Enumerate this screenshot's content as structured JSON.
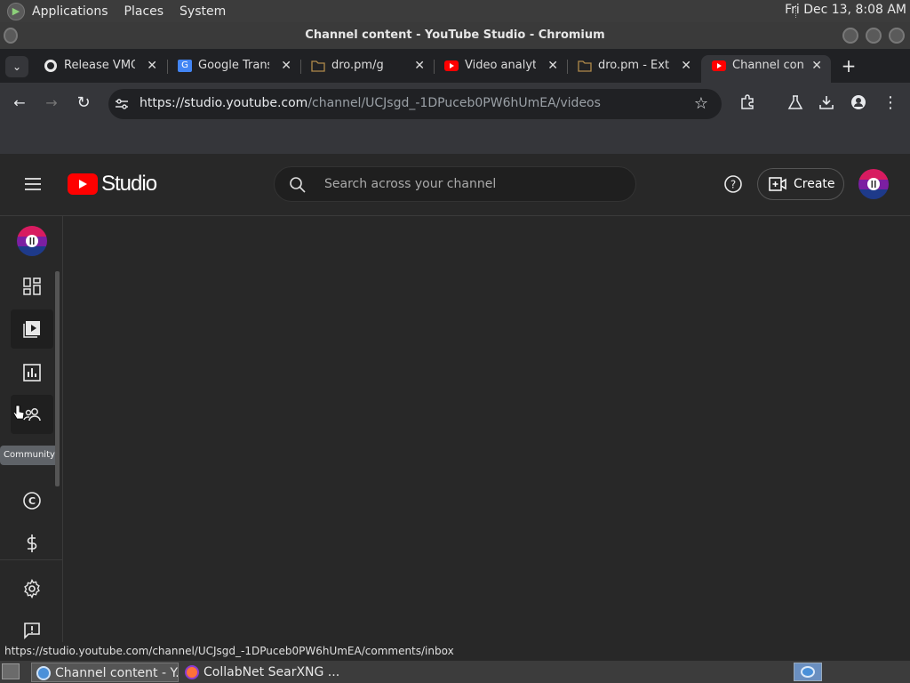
{
  "system_panel": {
    "menus": [
      "Applications",
      "Places",
      "System"
    ],
    "clock": "Fri Dec 13,  8:08 AM"
  },
  "window": {
    "title": "Channel content - YouTube Studio - Chromium"
  },
  "tabs": [
    {
      "label": "Release VMQ",
      "icon": "github-icon"
    },
    {
      "label": "Google Trans",
      "icon": "google-translate-icon"
    },
    {
      "label": "dro.pm/g",
      "icon": "folder-icon"
    },
    {
      "label": "Video analytic",
      "icon": "youtube-icon"
    },
    {
      "label": "dro.pm - Extr",
      "icon": "folder-icon"
    },
    {
      "label": "Channel cont",
      "icon": "youtube-icon",
      "active": true
    }
  ],
  "toolbar": {
    "url_host": "https://studio.youtube.com",
    "url_path": "/channel/UCJsgd_-1DPuceb0PW6hUmEA/videos"
  },
  "studio": {
    "brand": "Studio",
    "search_placeholder": "Search across your channel",
    "create_label": "Create",
    "tooltip": "Community",
    "accent": "#ff0000"
  },
  "status_bar": {
    "url": "https://studio.youtube.com/channel/UCJsgd_-1DPuceb0PW6hUmEA/comments/inbox"
  },
  "taskbar": {
    "tasks": [
      {
        "label": "Channel content - Y...",
        "active": true
      },
      {
        "label": "CollabNet SearXNG ...",
        "active": false
      }
    ]
  }
}
